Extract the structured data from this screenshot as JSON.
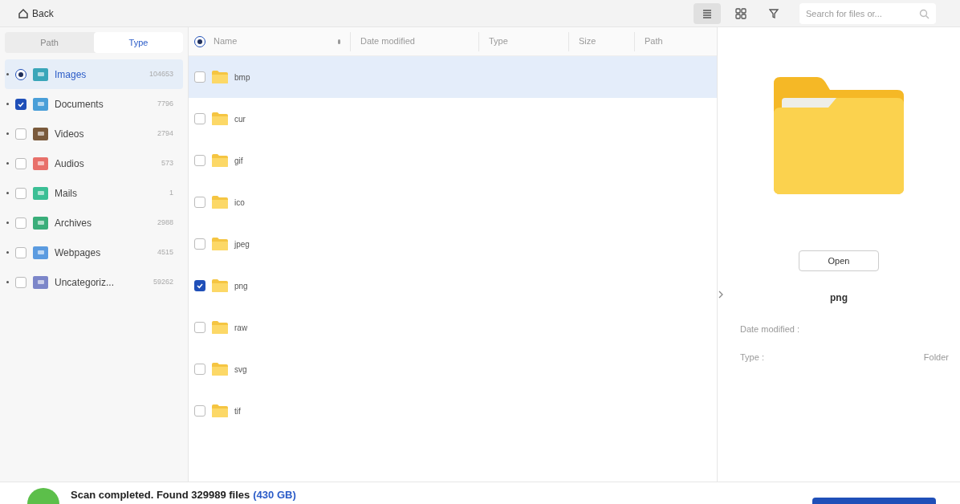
{
  "toolbar": {
    "back": "Back",
    "views": [
      {
        "kind": "list",
        "selected": true
      },
      {
        "kind": "grid",
        "selected": false
      },
      {
        "kind": "filter",
        "selected": false
      }
    ],
    "search": {
      "placeholder": "Search for files or..."
    }
  },
  "sidebar": {
    "tabs": [
      {
        "label": "Path",
        "selected": false
      },
      {
        "label": "Type",
        "selected": true
      }
    ],
    "items": [
      {
        "label": "Images",
        "count": "104653",
        "checked": true,
        "partial": true,
        "selected": true,
        "color": "#3aa6b9"
      },
      {
        "label": "Documents",
        "count": "7796",
        "checked": true,
        "partial": false,
        "selected": false,
        "color": "#4a9fd8"
      },
      {
        "label": "Videos",
        "count": "2794",
        "checked": false,
        "partial": false,
        "selected": false,
        "color": "#7a5a3c"
      },
      {
        "label": "Audios",
        "count": "573",
        "checked": false,
        "partial": false,
        "selected": false,
        "color": "#e8706a"
      },
      {
        "label": "Mails",
        "count": "1",
        "checked": false,
        "partial": false,
        "selected": false,
        "color": "#3bbf95"
      },
      {
        "label": "Archives",
        "count": "2988",
        "checked": false,
        "partial": false,
        "selected": false,
        "color": "#3aae7a"
      },
      {
        "label": "Webpages",
        "count": "4515",
        "checked": false,
        "partial": false,
        "selected": false,
        "color": "#5b9be0"
      },
      {
        "label": "Uncategoriz...",
        "count": "59262",
        "checked": false,
        "partial": false,
        "selected": false,
        "color": "#7c86c9"
      }
    ]
  },
  "table": {
    "header_partial": true,
    "columns": [
      "Name",
      "Date modified",
      "Type",
      "Size",
      "Path"
    ],
    "rows": [
      {
        "name": "bmp",
        "checked": false,
        "selected": true
      },
      {
        "name": "cur",
        "checked": false,
        "selected": false
      },
      {
        "name": "gif",
        "checked": false,
        "selected": false
      },
      {
        "name": "ico",
        "checked": false,
        "selected": false
      },
      {
        "name": "jpeg",
        "checked": false,
        "selected": false
      },
      {
        "name": "png",
        "checked": true,
        "selected": false
      },
      {
        "name": "raw",
        "checked": false,
        "selected": false
      },
      {
        "name": "svg",
        "checked": false,
        "selected": false
      },
      {
        "name": "tif",
        "checked": false,
        "selected": false
      }
    ]
  },
  "preview": {
    "open_button": "Open",
    "name": "png",
    "fields": [
      {
        "label": "Date modified :"
      },
      {
        "label": "Type :",
        "value": "Folder"
      }
    ]
  },
  "status_bar": {
    "message": "Scan completed. Found 329989 files",
    "size": "(430 GB)"
  }
}
